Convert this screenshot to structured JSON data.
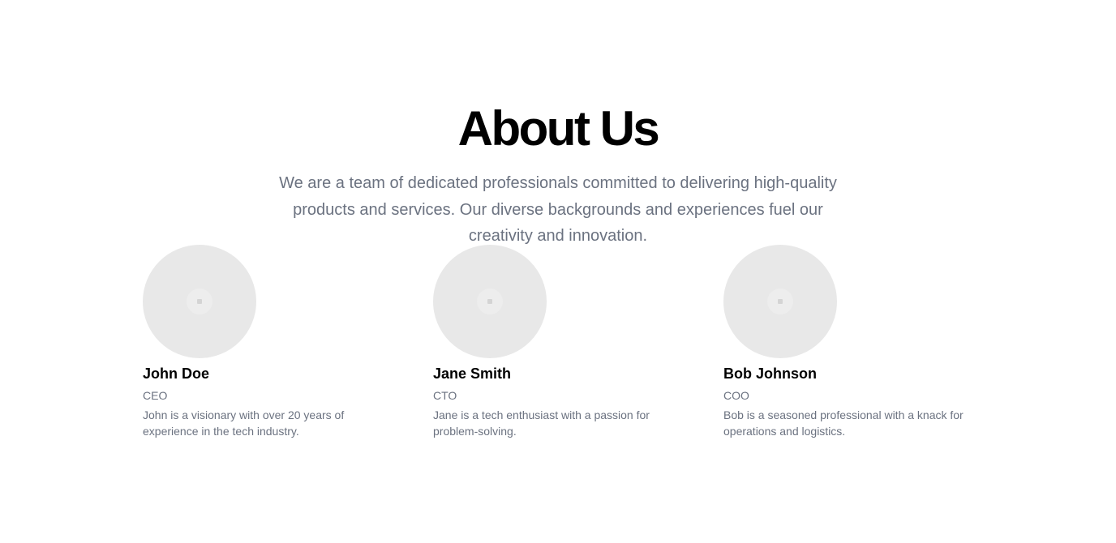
{
  "about": {
    "title": "About Us",
    "description": "We are a team of dedicated professionals committed to delivering high-quality products and services. Our diverse backgrounds and experiences fuel our creativity and innovation."
  },
  "team": [
    {
      "name": "John Doe",
      "role": "CEO",
      "bio": "John is a visionary with over 20 years of experience in the tech industry.",
      "avatar_icon": "image-placeholder-icon"
    },
    {
      "name": "Jane Smith",
      "role": "CTO",
      "bio": "Jane is a tech enthusiast with a passion for problem-solving.",
      "avatar_icon": "image-placeholder-icon"
    },
    {
      "name": "Bob Johnson",
      "role": "COO",
      "bio": "Bob is a seasoned professional with a knack for operations and logistics.",
      "avatar_icon": "image-placeholder-icon"
    }
  ],
  "colors": {
    "heading": "#000000",
    "muted_text": "#6b7280",
    "avatar_bg": "#e8e8e8",
    "background": "#ffffff"
  }
}
